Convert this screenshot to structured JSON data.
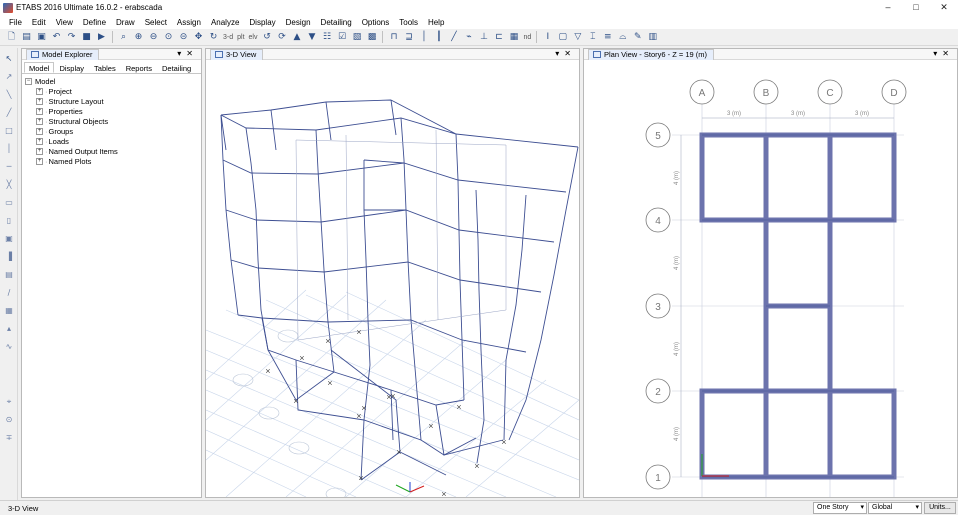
{
  "window": {
    "title": "ETABS 2016 Ultimate 16.0.2 - erabscada",
    "min": "–",
    "max": "□",
    "close": "✕"
  },
  "menu": [
    "File",
    "Edit",
    "View",
    "Define",
    "Draw",
    "Select",
    "Assign",
    "Analyze",
    "Display",
    "Design",
    "Detailing",
    "Options",
    "Tools",
    "Help"
  ],
  "toolbar": {
    "three_d": "3-d",
    "plan": "plt",
    "elev": "elv",
    "nd": "nd"
  },
  "model_explorer": {
    "title": "Model Explorer",
    "tabs": [
      "Model",
      "Display",
      "Tables",
      "Reports",
      "Detailing"
    ],
    "root": "Model",
    "items": [
      "Project",
      "Structure Layout",
      "Properties",
      "Structural Objects",
      "Groups",
      "Loads",
      "Named Output Items",
      "Named Plots"
    ]
  },
  "view3d": {
    "title": "3-D View"
  },
  "plan": {
    "title": "Plan View - Story6 - Z = 19 (m)",
    "grid_x": [
      "A",
      "B",
      "C",
      "D"
    ],
    "grid_y": [
      "5",
      "4",
      "3",
      "2",
      "1"
    ],
    "spacing_x": [
      "3 (m)",
      "3 (m)",
      "3 (m)"
    ],
    "spacing_y": [
      "4 (m)",
      "4 (m)",
      "4 (m)",
      "4 (m)"
    ]
  },
  "status": {
    "left": "3-D View",
    "story_select": "One Story",
    "coord_select": "Global",
    "units_button": "Units..."
  },
  "colors": {
    "frame": "#3e4f92",
    "beam": "#6c73ad",
    "grid": "#aab6d0"
  }
}
